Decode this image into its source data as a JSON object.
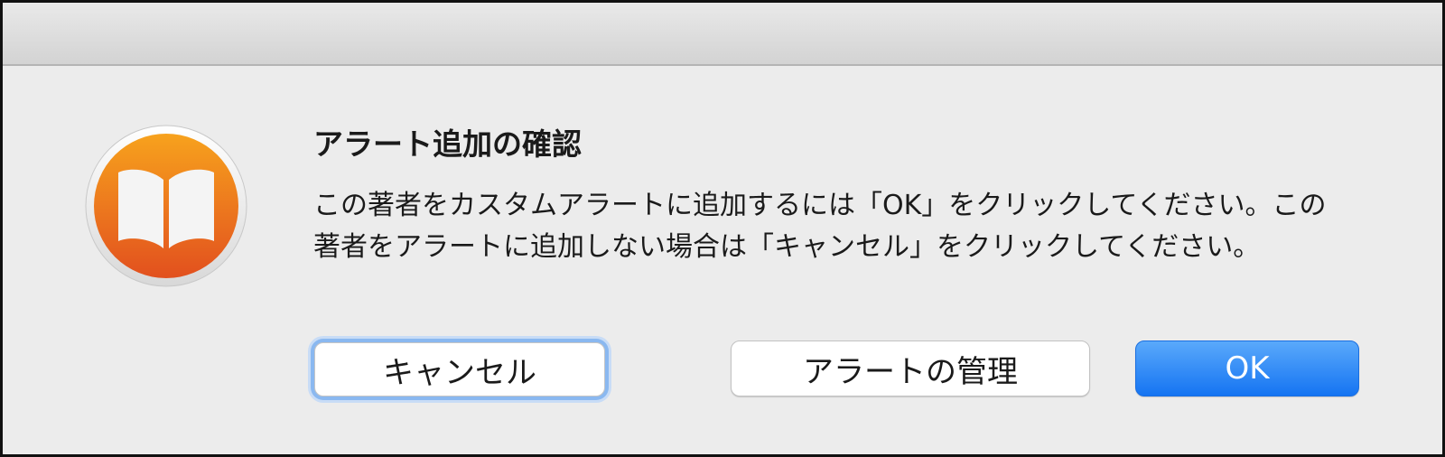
{
  "dialog": {
    "title": "アラート追加の確認",
    "message": "この著者をカスタムアラートに追加するには「OK」をクリックしてください。この著者をアラートに追加しない場合は「キャンセル」をクリックしてください。",
    "app_icon": "books-app-icon"
  },
  "buttons": {
    "cancel_label": "キャンセル",
    "manage_label": "アラートの管理",
    "ok_label": "OK"
  },
  "colors": {
    "accent_blue": "#1574f2",
    "icon_orange_top": "#f7a21d",
    "icon_orange_bottom": "#e2501e",
    "background": "#ececec"
  }
}
